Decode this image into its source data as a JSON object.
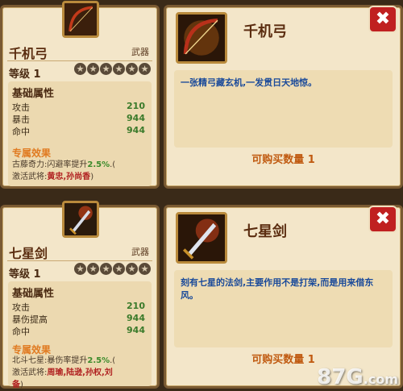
{
  "cards": [
    {
      "name": "千机弓",
      "type": "武器",
      "level": "等级 1",
      "stars": [
        "★",
        "★",
        "★",
        "★",
        "★",
        "★"
      ],
      "attrs_title": "基础属性",
      "attrs": [
        {
          "label": "攻击",
          "value": "210"
        },
        {
          "label": "暴击",
          "value": "944"
        },
        {
          "label": "命中",
          "value": "944"
        }
      ],
      "special_title": "专属效果",
      "special_line1_prefix": "古藤奇力:闪避率提升",
      "special_line1_value": "2.5%",
      "special_line1_suffix": ".(",
      "special_line2_prefix": "激活武将:",
      "special_line2_heroes": "黄忠,孙尚香",
      "special_line2_suffix": ")",
      "description": "一张精弓藏玄机,一发贯日天地惊。",
      "buy_label": "可购买数量 1"
    },
    {
      "name": "七星剑",
      "type": "武器",
      "level": "等级 1",
      "stars": [
        "★",
        "★",
        "★",
        "★",
        "★",
        "★"
      ],
      "attrs_title": "基础属性",
      "attrs": [
        {
          "label": "攻击",
          "value": "210"
        },
        {
          "label": "暴伤提高",
          "value": "944"
        },
        {
          "label": "命中",
          "value": "944"
        }
      ],
      "special_title": "专属效果",
      "special_line1_prefix": "北斗七星:暴伤率提升",
      "special_line1_value": "2.5%",
      "special_line1_suffix": ".(",
      "special_line2_prefix": "激活武将:",
      "special_line2_heroes": "周瑜,陆逊,孙权,刘",
      "special_line3_heroes": "备",
      "special_line3_suffix": ")",
      "description": "刻有七星的法剑,主要作用不是打架,而是用来借东风。",
      "buy_label": "可购买数量 1"
    }
  ],
  "close_label": "✖",
  "watermark_num": "87",
  "watermark_g": "G",
  "watermark_com": ".com"
}
